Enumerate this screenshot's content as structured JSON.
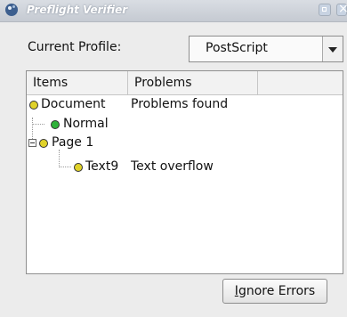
{
  "window": {
    "title": "Preflight Verifier"
  },
  "profile": {
    "label": "Current Profile:",
    "selected": "PostScript"
  },
  "tree": {
    "columns": [
      "Items",
      "Problems"
    ],
    "rows": [
      {
        "item": "Document",
        "problem": "Problems found",
        "status": "yellow"
      },
      {
        "item": "Normal",
        "problem": "",
        "status": "green"
      },
      {
        "item": "Page 1",
        "problem": "",
        "status": "yellow"
      },
      {
        "item": "Text9",
        "problem": "Text overflow",
        "status": "yellow"
      }
    ]
  },
  "buttons": {
    "ignore_accel": "I",
    "ignore_rest": "gnore Errors"
  }
}
